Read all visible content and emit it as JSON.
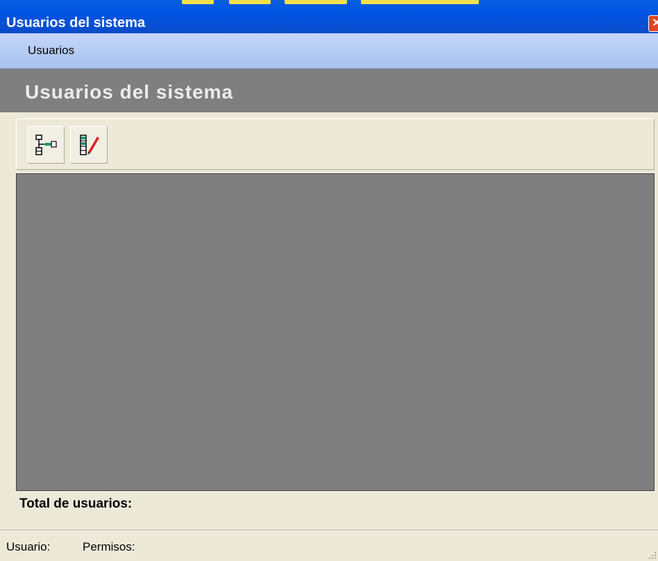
{
  "window": {
    "title": "Usuarios del sistema",
    "close_glyph": "✕"
  },
  "menu": {
    "items": [
      {
        "label": "Usuarios"
      }
    ]
  },
  "header": {
    "title": "Usuarios del sistema"
  },
  "toolbar": {
    "buttons": [
      {
        "icon": "assign-tree-icon"
      },
      {
        "icon": "edit-list-icon"
      }
    ]
  },
  "summary": {
    "total_label": "Total de usuarios:"
  },
  "status": {
    "user_label": "Usuario:",
    "permissions_label": "Permisos:"
  },
  "colors": {
    "titlebar": "#0054e3",
    "menubar": "#b9cff3",
    "panel": "#7f7f7f",
    "chrome": "#ece9d8",
    "edit_accent": "#e02020",
    "tree_accent": "#1a9a6a"
  }
}
